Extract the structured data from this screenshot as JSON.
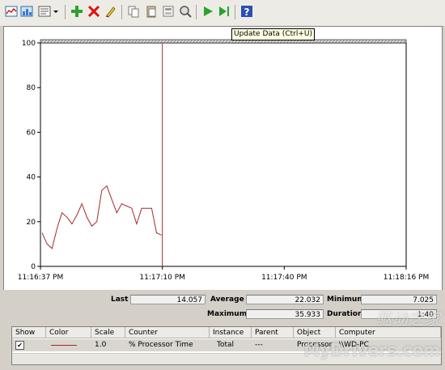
{
  "toolbar": {
    "buttons": [
      {
        "name": "view-graph-icon",
        "interactable": true
      },
      {
        "name": "view-histogram-icon",
        "interactable": true
      },
      {
        "name": "view-report-icon",
        "interactable": true
      },
      {
        "name": "dropdown-arrow-icon",
        "interactable": true
      },
      {
        "name": "add-counter-icon",
        "interactable": true
      },
      {
        "name": "delete-counter-icon",
        "interactable": true
      },
      {
        "name": "highlight-icon",
        "interactable": true
      },
      {
        "name": "copy-properties-icon",
        "interactable": true
      },
      {
        "name": "paste-counter-list-icon",
        "interactable": true
      },
      {
        "name": "properties-icon",
        "interactable": true
      },
      {
        "name": "freeze-display-icon",
        "interactable": true
      },
      {
        "name": "update-data-icon",
        "interactable": true
      },
      {
        "name": "play-icon",
        "interactable": true
      },
      {
        "name": "help-icon",
        "interactable": true
      }
    ],
    "tooltip": "Update Data (Ctrl+U)"
  },
  "chart_data": {
    "type": "line",
    "title": "",
    "xlabel": "",
    "ylabel": "",
    "ylim": [
      0,
      100
    ],
    "yticks": [
      "0",
      "20",
      "40",
      "60",
      "80",
      "100"
    ],
    "xticks": [
      "11:16:37 PM",
      "11:17:10 PM",
      "11:17:40 PM",
      "11:18:16 PM"
    ],
    "grid": false,
    "series": [
      {
        "color": "#a52a2a",
        "values": [
          15,
          10,
          8,
          17,
          24,
          22,
          19,
          23,
          28,
          22,
          18,
          20,
          34,
          36,
          30,
          24,
          28,
          27,
          26,
          19,
          26,
          26,
          26,
          15,
          14
        ]
      }
    ],
    "current_position_time": "11:17:10 PM"
  },
  "stats": {
    "last_label": "Last",
    "last_value": "14.057",
    "average_label": "Average",
    "average_value": "22.032",
    "minimum_label": "Minimum",
    "minimum_value": "7.025",
    "maximum_label": "Maximum",
    "maximum_value": "35.933",
    "duration_label": "Duration",
    "duration_value": "1:40"
  },
  "legend": {
    "columns": [
      "Show",
      "Color",
      "Scale",
      "Counter",
      "Instance",
      "Parent",
      "Object",
      "Computer"
    ],
    "rows": [
      {
        "show": "✔",
        "color": "#a52a2a",
        "scale": "1.0",
        "counter": "% Processor Time",
        "instance": "Total",
        "parent": "---",
        "object": "Processor",
        "computer": "\\\\WD-PC"
      }
    ]
  },
  "watermark": {
    "text1": "驱动之家",
    "text2": "MyDrivers.com"
  }
}
